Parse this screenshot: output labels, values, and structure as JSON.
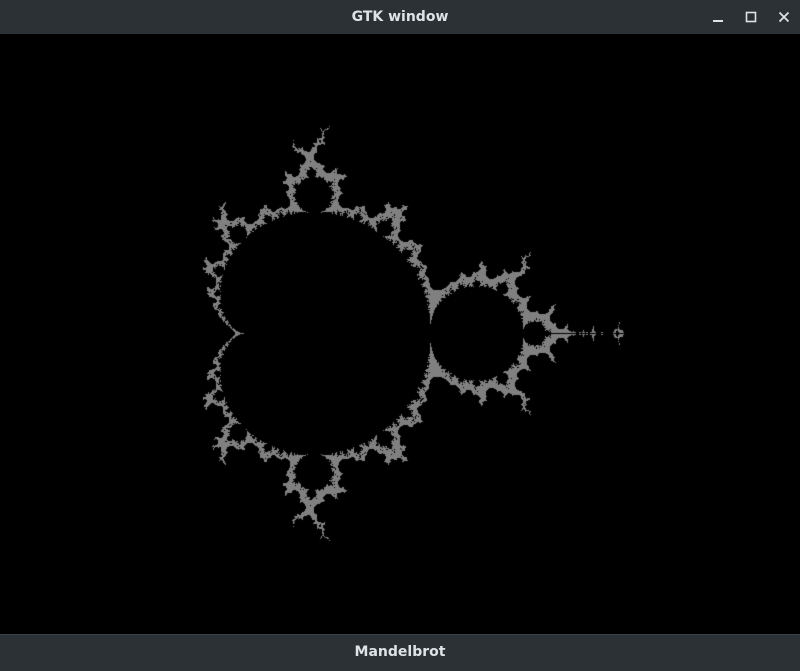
{
  "window": {
    "title": "GTK window",
    "controls": {
      "minimize_icon": "minimize-icon",
      "maximize_icon": "maximize-icon",
      "close_icon": "close-icon"
    }
  },
  "canvas": {
    "fractal": "mandelbrot",
    "background_color": "#000000",
    "boundary_color": "#808080"
  },
  "bottom_button": {
    "label": "Mandelbrot"
  },
  "colors": {
    "titlebar": "#2b3134",
    "title_text": "#dfe3e5"
  }
}
